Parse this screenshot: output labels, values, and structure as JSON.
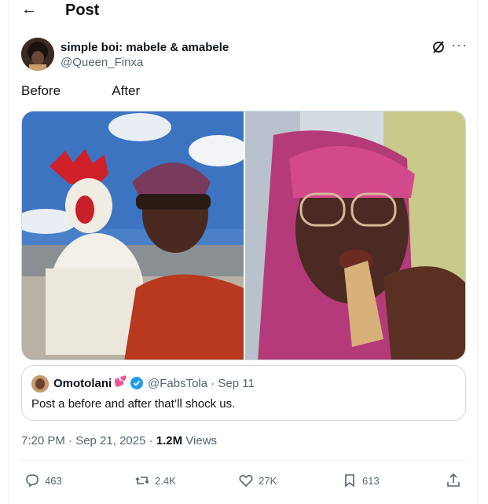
{
  "header": {
    "title": "Post",
    "back_icon": "arrow-left-icon"
  },
  "author": {
    "display_name": "simple boi: mabele & amabele",
    "handle": "@Queen_Finxa"
  },
  "post": {
    "text": "Before              After"
  },
  "quote": {
    "name": "Omotolani",
    "name_emoji": "💕",
    "handle_time": "@FabsTola · Sep 11",
    "text": "Post a before and after that’ll shock us."
  },
  "meta": {
    "time": "7:20 PM · Sep 21, 2025 · ",
    "views_count": "1.2M",
    "views_label": " Views"
  },
  "actions": {
    "replies": "463",
    "reposts": "2.4K",
    "likes": "27K",
    "bookmarks": "613"
  },
  "colors": {
    "accent": "#1d9bf0",
    "muted": "#536471",
    "border": "#cfd9de"
  }
}
